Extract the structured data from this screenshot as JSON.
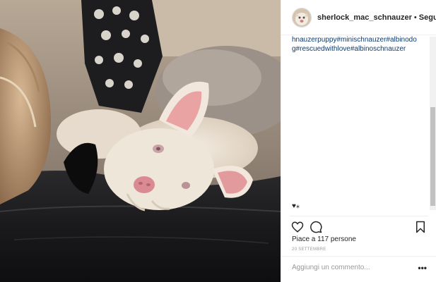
{
  "post": {
    "photo_description_alt": "",
    "header": {
      "username": "sherlock_mac_schnauzer",
      "separator": "•",
      "follow_label": "Segui già"
    },
    "caption": {
      "hashtags": "hnauzerpuppy#minischnauzer#albinodog#rescuedwithlove#albinoschnauzer"
    },
    "small_icon_text": "♥⁎",
    "actions": {
      "like_icon": "heart-icon",
      "comment_icon": "comment-icon",
      "save_icon": "bookmark-icon"
    },
    "likes_text": "Piace a 117 persone",
    "date": "20 SETTEMBRE",
    "add_comment": {
      "placeholder": "Aggiungi un commento...",
      "more_label": "•••"
    }
  },
  "colors": {
    "text": "#262626",
    "link": "#003569",
    "muted": "#999999",
    "border": "#efefef"
  }
}
